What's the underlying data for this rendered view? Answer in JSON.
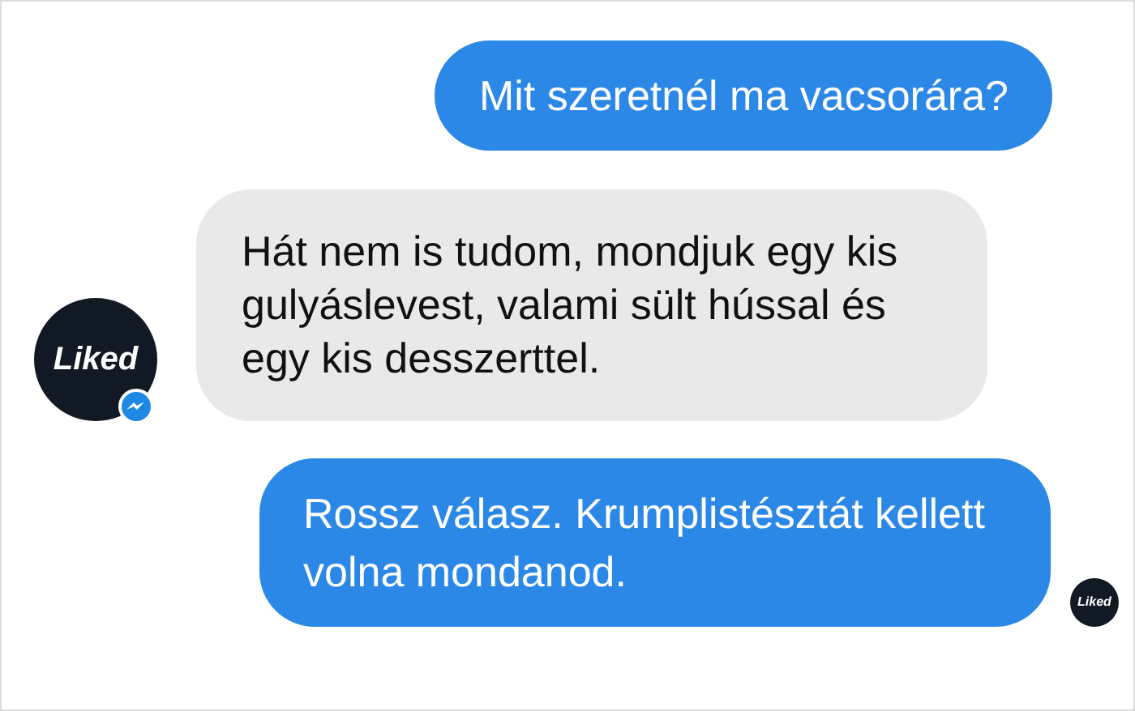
{
  "messages": [
    {
      "kind": "outgoing",
      "text": "Mit szeretnél ma vacsorára?"
    },
    {
      "kind": "incoming",
      "text": "Hát nem is tudom, mondjuk egy kis gulyáslevest, valami sült hússal és egy kis desszerttel.",
      "avatar": "Liked"
    },
    {
      "kind": "outgoing",
      "text": "Rossz válasz. Krumplistésztát kellett volna mondanod.",
      "seen_avatar": "Liked"
    }
  ]
}
